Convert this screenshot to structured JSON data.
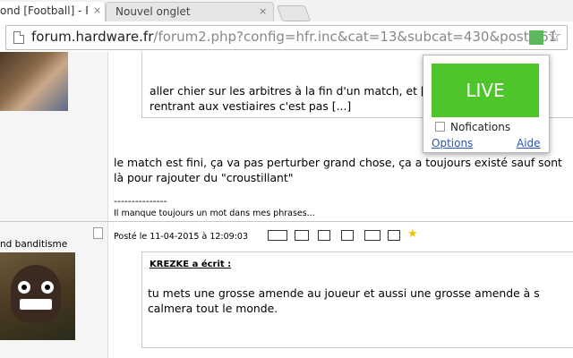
{
  "tabs": [
    {
      "title": "ond [Football] - P"
    },
    {
      "title": "Nouvel onglet"
    }
  ],
  "address_bar": {
    "host": "forum.hardware.fr",
    "path": "/forum2.php?config=hfr.inc&cat=13&subcat=430&post=61"
  },
  "post1": {
    "quote_text": "aller chier sur les arbitres à la fin d'un match, et [...]vant caméras en rentrant aux vestiaires c'est pas [...]",
    "message": "le match est fini, ça va pas perturber grand chose, ça a toujours existé sauf sont là pour rajouter du \"croustillant\"",
    "sig_separator": "---------------",
    "signature": "Il manque toujours un mot dans mes phrases..."
  },
  "post2": {
    "username": "nd banditisme",
    "date": "Posté le 11-04-2015 à 12:09:03",
    "quote_author": "KREZKE a écrit :",
    "quote_text": "tu mets une grosse amende au joueur et aussi une grosse amende à s calmera tout le monde."
  },
  "popup": {
    "live_label": "LIVE",
    "notif_label": "Nofications",
    "options_label": "Options",
    "help_label": "Aide",
    "accent": "#4ec52a"
  },
  "icons": {
    "close": "×",
    "star": "☆",
    "fav": "★"
  }
}
